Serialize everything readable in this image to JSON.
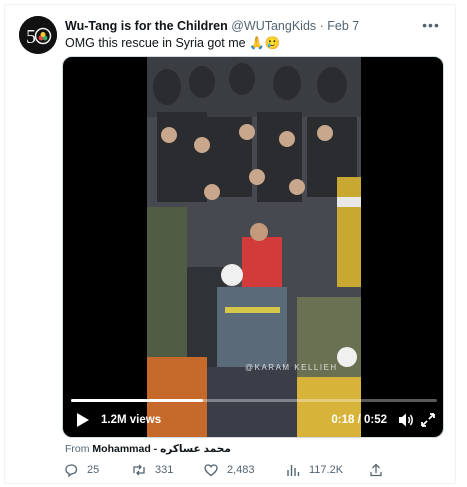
{
  "author": {
    "display_name": "Wu-Tang is for the Children",
    "handle": "@WUTangKids",
    "date": "Feb 7",
    "separator": "·",
    "avatar_icon": "wutang-50-logo-icon"
  },
  "tweet": {
    "text": "OMG this rescue in Syria got me 🙏🥲"
  },
  "video": {
    "views": "1.2M views",
    "time": "0:18 / 0:52",
    "progress_fraction": 0.36,
    "watermark": "@KARAM KELLIEH"
  },
  "source": {
    "prefix": "From",
    "name": "Mohammad - محمد عساكره"
  },
  "actions": {
    "replies": "25",
    "retweets": "331",
    "likes": "2,483",
    "views": "117.2K"
  },
  "colors": {
    "secondary_text": "#536471",
    "primary_text": "#0f1419",
    "media_bg": "#000000"
  }
}
